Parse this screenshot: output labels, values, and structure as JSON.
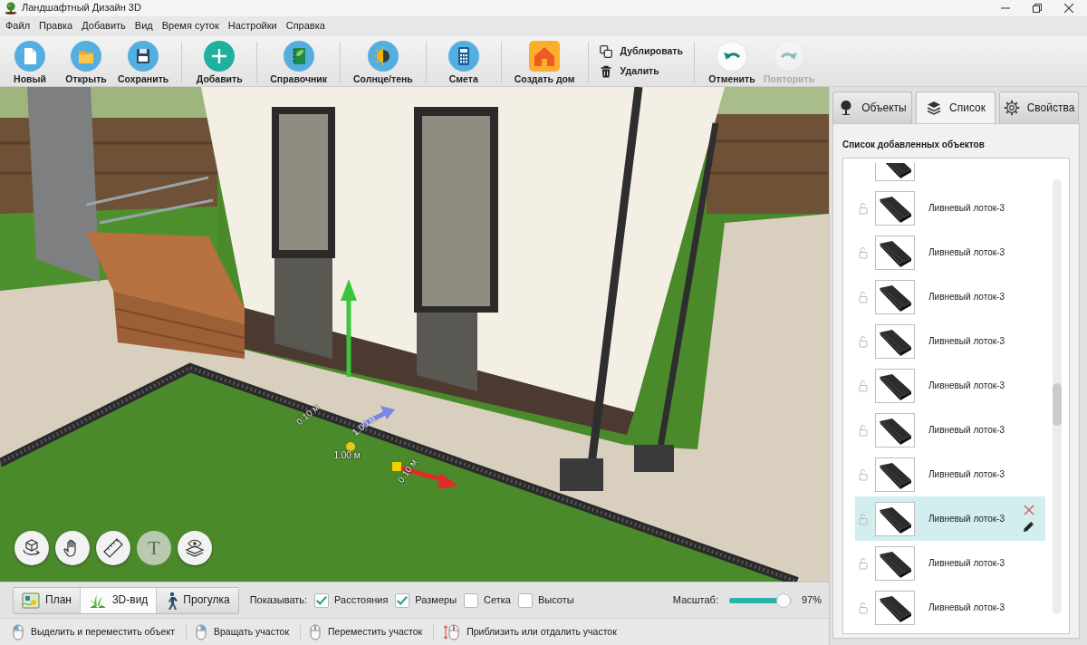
{
  "window": {
    "title": "Ландшафтный Дизайн 3D"
  },
  "menu": [
    "Файл",
    "Правка",
    "Добавить",
    "Вид",
    "Время суток",
    "Настройки",
    "Справка"
  ],
  "toolbar": [
    {
      "kind": "large",
      "buttons": [
        {
          "label": "Новый",
          "kind": "file",
          "disabled": false
        },
        {
          "label": "Открыть",
          "kind": "folder",
          "disabled": false
        },
        {
          "label": "Сохранить",
          "kind": "save",
          "disabled": false
        }
      ]
    },
    {
      "kind": "large",
      "buttons": [
        {
          "label": "Добавить",
          "kind": "add",
          "disabled": false
        }
      ]
    },
    {
      "kind": "large",
      "buttons": [
        {
          "label": "Справочник",
          "kind": "book",
          "disabled": false
        }
      ]
    },
    {
      "kind": "large",
      "buttons": [
        {
          "label": "Солнце/тень",
          "kind": "sun",
          "disabled": false
        }
      ]
    },
    {
      "kind": "large",
      "buttons": [
        {
          "label": "Смета",
          "kind": "calc",
          "disabled": false
        }
      ]
    },
    {
      "kind": "large",
      "buttons": [
        {
          "label": "Создать дом",
          "kind": "house",
          "disabled": false
        }
      ]
    },
    {
      "kind": "small",
      "buttons": [
        {
          "label": "Дублировать",
          "kind": "duplicate",
          "disabled": false
        },
        {
          "label": "Удалить",
          "kind": "trash",
          "disabled": false
        }
      ]
    },
    {
      "kind": "large",
      "buttons": [
        {
          "label": "Отменить",
          "kind": "undo",
          "disabled": false
        },
        {
          "label": "Повторить",
          "kind": "redo",
          "disabled": true
        }
      ]
    }
  ],
  "viewport": {
    "labels": [
      "0.10 м",
      "1.00 м",
      "0.10 м",
      "1.00 м"
    ],
    "tools": [
      {
        "kind": "rotate",
        "disabled": false
      },
      {
        "kind": "hand",
        "disabled": false
      },
      {
        "kind": "ruler",
        "disabled": false
      },
      {
        "kind": "text",
        "label": "T",
        "disabled": true
      },
      {
        "kind": "layers",
        "disabled": false
      }
    ]
  },
  "view_bar": {
    "modes": [
      {
        "label": "План",
        "kind": "plan",
        "selected": false
      },
      {
        "label": "3D-вид",
        "kind": "scene",
        "selected": true
      },
      {
        "label": "Прогулка",
        "kind": "walk",
        "selected": false
      }
    ],
    "show": {
      "label": "Показывать:",
      "options": [
        {
          "label": "Расстояния",
          "checked": true
        },
        {
          "label": "Размеры",
          "checked": true
        },
        {
          "label": "Сетка",
          "checked": false
        },
        {
          "label": "Высоты",
          "checked": false
        }
      ]
    },
    "zoom": {
      "label": "Масштаб:",
      "level": 0.97,
      "reading": "97%"
    }
  },
  "status_bar": [
    {
      "text": "Выделить и переместить объект",
      "kind": "left"
    },
    {
      "text": "Вращать участок",
      "kind": "right"
    },
    {
      "text": "Переместить участок",
      "kind": "middle"
    },
    {
      "text": "Приблизить или отдалить участок",
      "kind": "scroll"
    }
  ],
  "sidebar": {
    "tabs": [
      {
        "label": "Объекты",
        "kind": "objects",
        "selected": false
      },
      {
        "label": "Список",
        "kind": "list",
        "selected": true
      },
      {
        "label": "Свойства",
        "kind": "properties",
        "selected": false
      }
    ],
    "heading": "Список добавленных объектов",
    "items": [
      {
        "kind": "cut",
        "selected": false
      },
      {
        "kind": "row",
        "label": "Ливневый лоток-3",
        "selected": false
      },
      {
        "kind": "row",
        "label": "Ливневый лоток-3",
        "selected": false
      },
      {
        "kind": "row",
        "label": "Ливневый лоток-3",
        "selected": false
      },
      {
        "kind": "row",
        "label": "Ливневый лоток-3",
        "selected": false
      },
      {
        "kind": "row",
        "label": "Ливневый лоток-3",
        "selected": false
      },
      {
        "kind": "row",
        "label": "Ливневый лоток-3",
        "selected": false
      },
      {
        "kind": "row",
        "label": "Ливневый лоток-3",
        "selected": false
      },
      {
        "kind": "row",
        "label": "Ливневый лоток-3",
        "selected": true
      },
      {
        "kind": "row",
        "label": "Ливневый лоток-3",
        "selected": false
      },
      {
        "kind": "row",
        "label": "Ливневый лоток-3",
        "selected": false
      }
    ]
  }
}
